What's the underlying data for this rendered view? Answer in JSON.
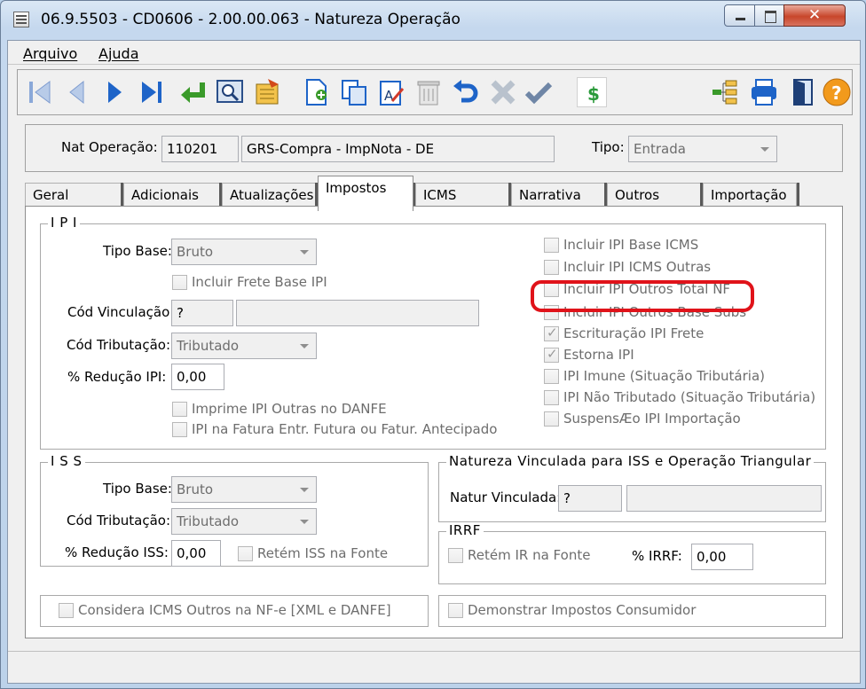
{
  "window": {
    "title": "06.9.5503 - CD0606 - 2.00.00.063 - Natureza Operação"
  },
  "menu": {
    "arquivo": "Arquivo",
    "ajuda": "Ajuda"
  },
  "header": {
    "nat_operacao_label": "Nat Operação:",
    "nat_operacao_code": "110201",
    "nat_operacao_desc": "GRS-Compra - ImpNota - DE",
    "tipo_label": "Tipo:",
    "tipo_value": "Entrada"
  },
  "tabs": [
    "Geral",
    "Adicionais",
    "Atualizações",
    "Impostos",
    "ICMS",
    "Narrativa",
    "Outros",
    "Importação"
  ],
  "ipi": {
    "title": "I P I",
    "tipo_base_label": "Tipo Base:",
    "tipo_base_value": "Bruto",
    "incluir_frete": "Incluir Frete Base IPI",
    "cod_vinculacao_label": "Cód Vinculação:",
    "cod_vinculacao_value": "?",
    "cod_tributacao_label": "Cód Tributação:",
    "cod_tributacao_value": "Tributado",
    "reducao_label": "% Redução IPI:",
    "reducao_value": "0,00",
    "imprime_ipi_outras": "Imprime IPI Outras no DANFE",
    "ipi_fatura": "IPI na Fatura Entr. Futura ou Fatur. Antecipado",
    "right_checks": [
      {
        "label": "Incluir IPI Base ICMS",
        "checked": false
      },
      {
        "label": "Incluir IPI ICMS Outras",
        "checked": false
      },
      {
        "label": "Incluir IPI Outros Total NF",
        "checked": false
      },
      {
        "label": "Incluir IPI Outros Base Subs",
        "checked": false
      },
      {
        "label": "Escrituração IPI Frete",
        "checked": true
      },
      {
        "label": "Estorna IPI",
        "checked": true
      },
      {
        "label": "IPI Imune (Situação Tributária)",
        "checked": false
      },
      {
        "label": "IPI Não Tributado (Situação Tributária)",
        "checked": false
      },
      {
        "label": "SuspensÆo IPI Importação",
        "checked": false
      }
    ]
  },
  "iss": {
    "title": "I S S",
    "tipo_base_label": "Tipo Base:",
    "tipo_base_value": "Bruto",
    "cod_tributacao_label": "Cód Tributação:",
    "cod_tributacao_value": "Tributado",
    "reducao_label": "% Redução ISS:",
    "reducao_value": "0,00",
    "retem_iss": "Retém ISS na Fonte"
  },
  "natureza_vinculada": {
    "title": "Natureza Vinculada para ISS e Operação Triangular",
    "label": "Natur Vinculada:",
    "value": "?"
  },
  "irrf": {
    "title": "IRRF",
    "retem_ir": "Retém IR na Fonte",
    "percent_label": "% IRRF:",
    "percent_value": "0,00"
  },
  "bottom": {
    "considera_icms": "Considera ICMS Outros na NF-e [XML e DANFE]",
    "demonstrar": "Demonstrar Impostos Consumidor"
  },
  "colors": {
    "highlight": "#e0131a",
    "toolbar_blue": "#1e64c8",
    "help_orange": "#f29a1c"
  }
}
